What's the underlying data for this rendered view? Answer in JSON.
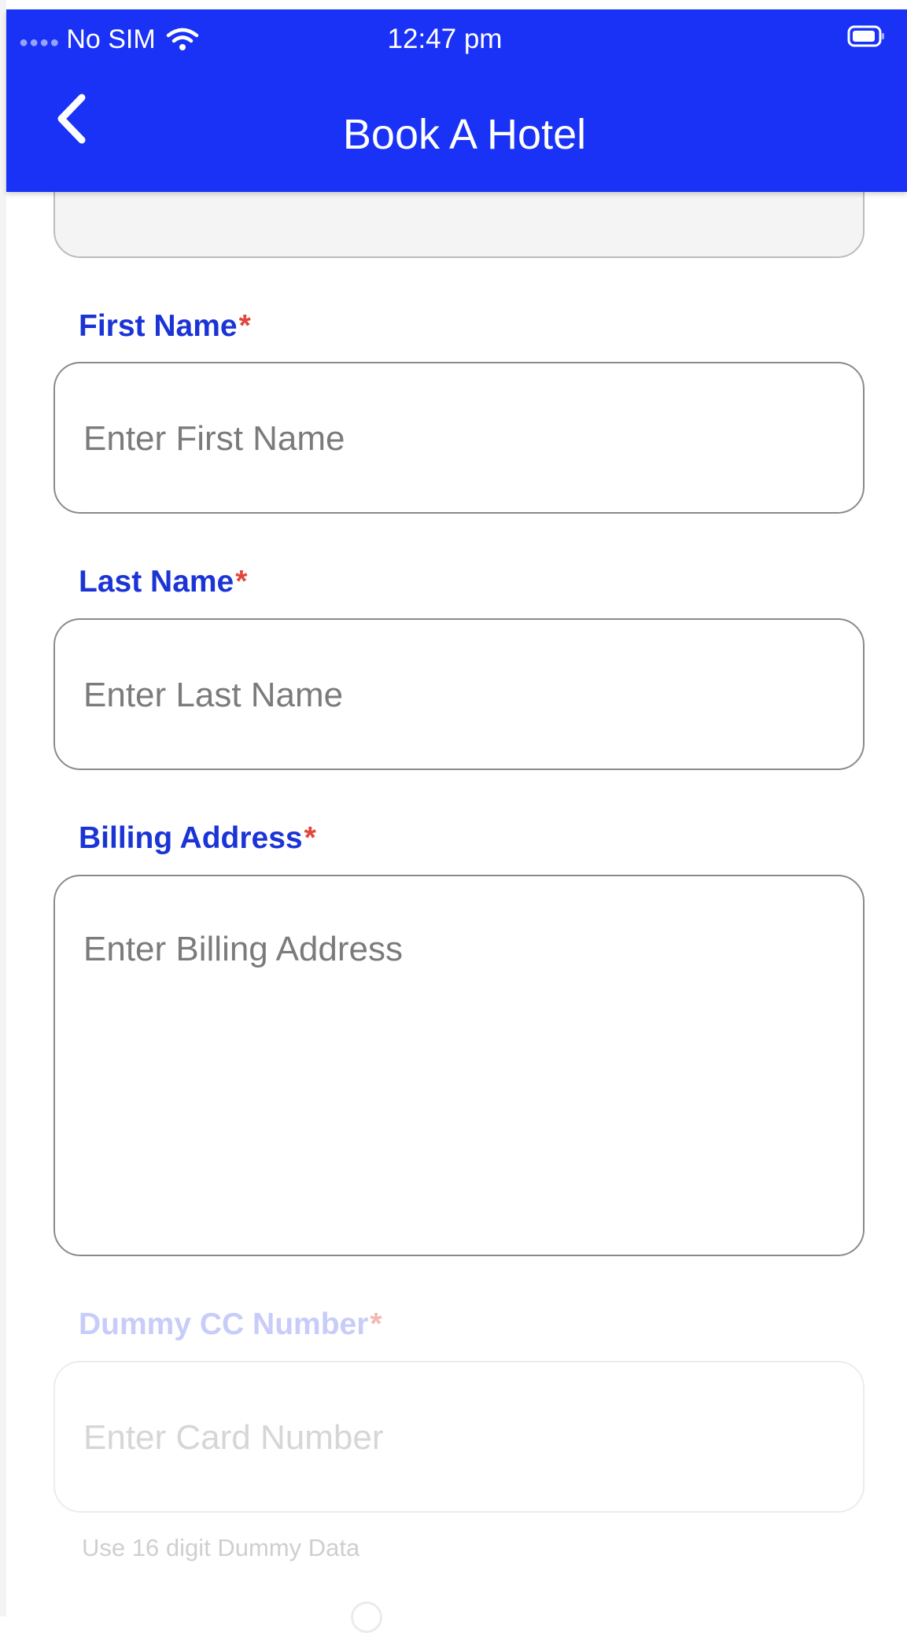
{
  "status_bar": {
    "carrier": "No SIM",
    "time": "12:47 pm"
  },
  "header": {
    "title": "Book A Hotel"
  },
  "form": {
    "first_name": {
      "label": "First Name",
      "required_mark": "*",
      "placeholder": "Enter First Name"
    },
    "last_name": {
      "label": "Last Name",
      "required_mark": "*",
      "placeholder": "Enter Last Name"
    },
    "billing_address": {
      "label": "Billing Address",
      "required_mark": "*",
      "placeholder": "Enter Billing Address"
    },
    "cc_number": {
      "label": "Dummy CC Number",
      "required_mark": "*",
      "placeholder": "Enter Card Number",
      "hint": "Use 16 digit Dummy Data"
    }
  },
  "colors": {
    "appbar": "#1a32f5",
    "label": "#1b34d6",
    "required": "#e2453c"
  }
}
